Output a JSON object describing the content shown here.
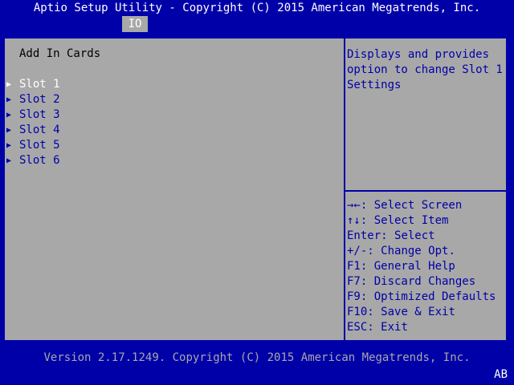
{
  "header": {
    "title": "Aptio Setup Utility - Copyright (C) 2015 American Megatrends, Inc.",
    "tabs": [
      {
        "label": "IO"
      }
    ]
  },
  "main": {
    "heading": "Add In Cards",
    "items": [
      {
        "label": "Slot 1"
      },
      {
        "label": "Slot 2"
      },
      {
        "label": "Slot 3"
      },
      {
        "label": "Slot 4"
      },
      {
        "label": "Slot 5"
      },
      {
        "label": "Slot 6"
      }
    ],
    "arrow_glyph": "▶"
  },
  "help": {
    "text": "Displays and provides option to change Slot 1 Settings"
  },
  "keys": [
    {
      "key": "→←",
      "desc": ": Select Screen"
    },
    {
      "key": "↑↓",
      "desc": ": Select Item"
    },
    {
      "key": "Enter",
      "desc": ": Select"
    },
    {
      "key": "+/-",
      "desc": ": Change Opt."
    },
    {
      "key": "F1",
      "desc": ": General Help"
    },
    {
      "key": "F7",
      "desc": ": Discard Changes"
    },
    {
      "key": "F9",
      "desc": ": Optimized Defaults"
    },
    {
      "key": "F10",
      "desc": ": Save & Exit"
    },
    {
      "key": "ESC",
      "desc": ": Exit"
    }
  ],
  "footer": {
    "version": "Version 2.17.1249. Copyright (C) 2015 American Megatrends, Inc.",
    "code": "AB"
  },
  "colors": {
    "frame": "#0000a8",
    "panel": "#a8a8a8",
    "selected_text": "#ffffff",
    "normal_text": "#0000a8"
  }
}
